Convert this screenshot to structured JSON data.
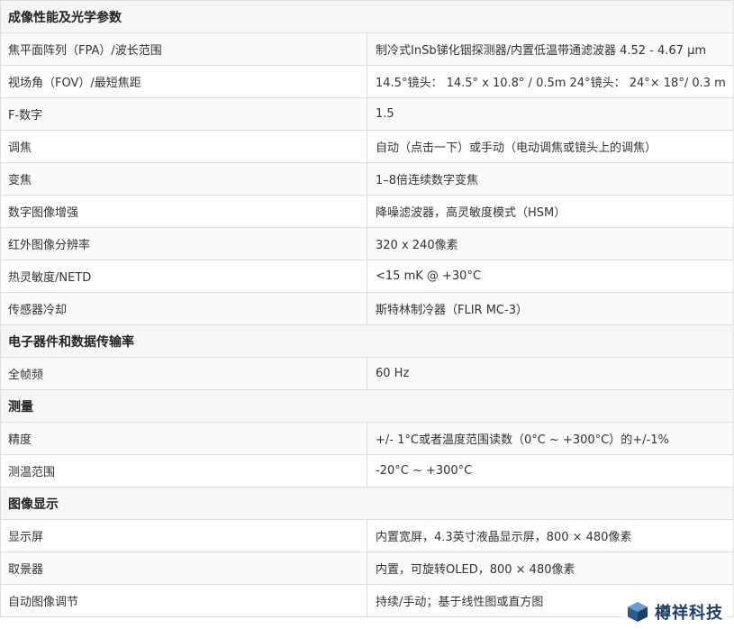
{
  "sections": [
    {
      "title": "成像性能及光学参数",
      "rows": [
        {
          "label": "焦平面阵列（FPA）/波长范围",
          "value": "制冷式InSb锑化铟探测器/内置低温带通滤波器 4.52 - 4.67 µm"
        },
        {
          "label": "视场角（FOV）/最短焦距",
          "value": "14.5°镜头： 14.5° x 10.8° / 0.5m 24°镜头： 24°× 18°/ 0.3 m"
        },
        {
          "label": "F-数字",
          "value": "1.5"
        },
        {
          "label": "调焦",
          "value": "自动（点击一下）或手动（电动调焦或镜头上的调焦）"
        },
        {
          "label": "变焦",
          "value": "1–8倍连续数字变焦"
        },
        {
          "label": "数字图像增强",
          "value": "降噪滤波器，高灵敏度模式（HSM）"
        },
        {
          "label": "红外图像分辨率",
          "value": "320 x 240像素"
        },
        {
          "label": "热灵敏度/NETD",
          "value": "<15 mK @ +30°C"
        },
        {
          "label": "传感器冷却",
          "value": "斯特林制冷器（FLIR MC-3）"
        }
      ]
    },
    {
      "title": "电子器件和数据传输率",
      "rows": [
        {
          "label": "全帧频",
          "value": "60 Hz"
        }
      ]
    },
    {
      "title": "测量",
      "rows": [
        {
          "label": "精度",
          "value": "+/- 1°C或者温度范围读数（0°C ~ +300°C）的+/-1%"
        },
        {
          "label": "测温范围",
          "value": "-20°C ~ +300°C"
        }
      ]
    },
    {
      "title": "图像显示",
      "rows": [
        {
          "label": "显示屏",
          "value": "内置宽屏，4.3英寸液晶显示屏，800 × 480像素"
        },
        {
          "label": "取景器",
          "value": "内置，可旋转OLED，800 × 480像素"
        },
        {
          "label": "自动图像调节",
          "value": "持续/手动；基于线性图或直方图"
        }
      ]
    }
  ],
  "watermark": {
    "text": "樽祥科技",
    "icon": "cube-logo-icon",
    "color": "#1f3f66"
  }
}
